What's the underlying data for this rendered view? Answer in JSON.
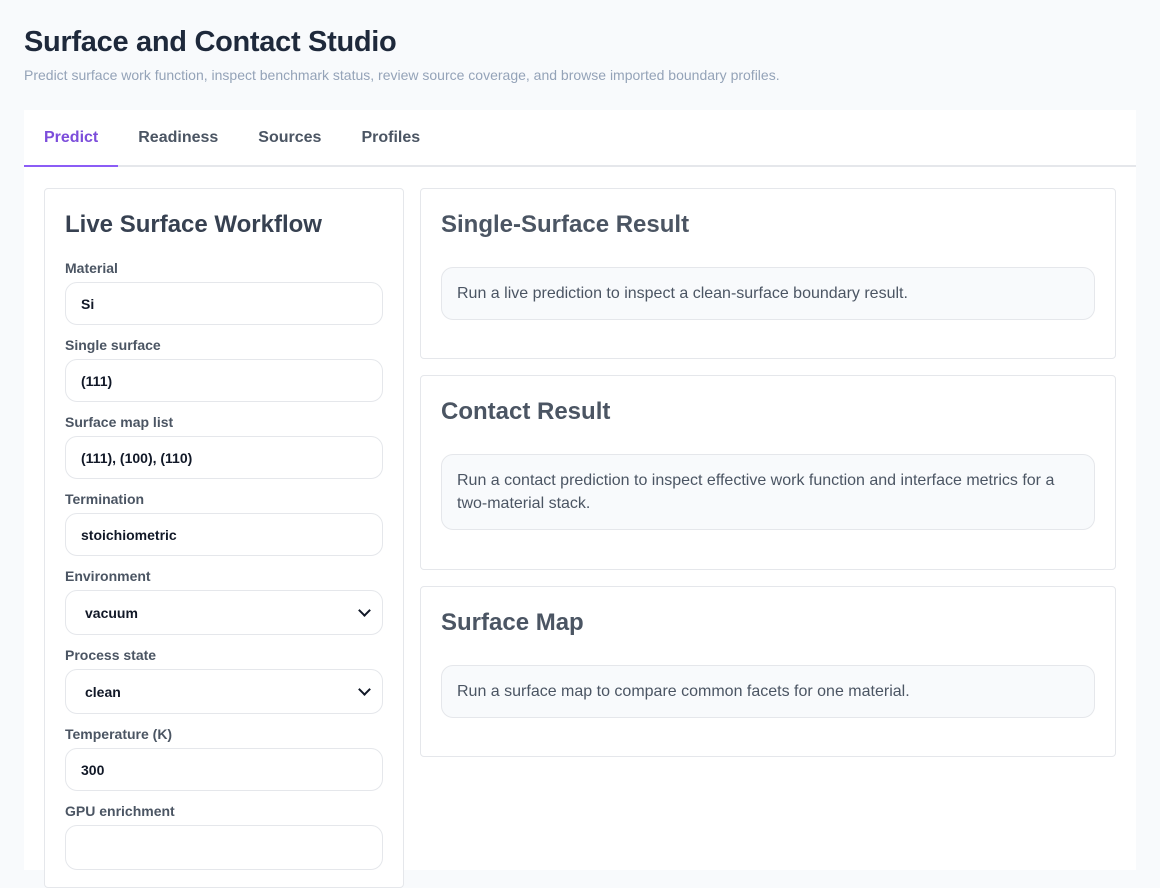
{
  "header": {
    "title": "Surface and Contact Studio",
    "subtitle": "Predict surface work function, inspect benchmark status, review source coverage, and browse imported boundary profiles."
  },
  "tabs": [
    {
      "label": "Predict",
      "active": true
    },
    {
      "label": "Readiness",
      "active": false
    },
    {
      "label": "Sources",
      "active": false
    },
    {
      "label": "Profiles",
      "active": false
    }
  ],
  "workflow": {
    "title": "Live Surface Workflow",
    "material": {
      "label": "Material",
      "value": "Si"
    },
    "single_surface": {
      "label": "Single surface",
      "value": "(111)"
    },
    "surface_map_list": {
      "label": "Surface map list",
      "value": "(111), (100), (110)"
    },
    "termination": {
      "label": "Termination",
      "value": "stoichiometric"
    },
    "environment": {
      "label": "Environment",
      "value": "vacuum"
    },
    "process_state": {
      "label": "Process state",
      "value": "clean"
    },
    "temperature": {
      "label": "Temperature (K)",
      "value": "300"
    },
    "gpu_enrichment": {
      "label": "GPU enrichment"
    }
  },
  "single_surface_result": {
    "title": "Single-Surface Result",
    "message": "Run a live prediction to inspect a clean-surface boundary result."
  },
  "contact_result": {
    "title": "Contact Result",
    "message": "Run a contact prediction to inspect effective work function and interface metrics for a two-material stack."
  },
  "surface_map": {
    "title": "Surface Map",
    "message": "Run a surface map to compare common facets for one material."
  },
  "colors": {
    "accent": "#8b5cf6",
    "accent_text": "#7c4ddb",
    "border": "#e5e7eb",
    "page_bg": "#f8fafc"
  }
}
